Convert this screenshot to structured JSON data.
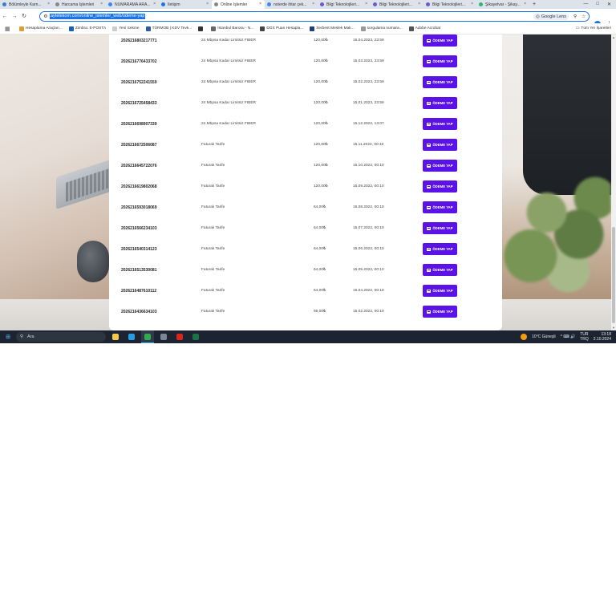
{
  "browser": {
    "tabs": [
      {
        "title": "Bölümleyle Karn...",
        "color": "#3a7bd5"
      },
      {
        "title": "Harcama İşlemleri",
        "color": "#888888"
      },
      {
        "title": "NUMARAMA ARA...",
        "color": "#4285f4"
      },
      {
        "title": "İletişim",
        "color": "#1a73e8"
      },
      {
        "title": "Online İşlemler",
        "color": "#888888"
      },
      {
        "title": "noterde ihtar çek...",
        "color": "#4285f4"
      },
      {
        "title": "Bilgi Teknolojileri...",
        "color": "#6a5acd"
      },
      {
        "title": "Bilgi Teknolojileri...",
        "color": "#6a5acd"
      },
      {
        "title": "Bilgi Teknolojileri...",
        "color": "#6a5acd"
      },
      {
        "title": "Şikayetvar - Şikay...",
        "color": "#2ab673"
      }
    ],
    "active_tab_index": 4,
    "new_tab": "+",
    "window_controls": [
      "—",
      "□",
      "✕"
    ],
    "nav": {
      "back": "←",
      "forward": "→",
      "reload": "↻"
    },
    "url": "aytelekom.com/online_islemler_web/odeme-yap",
    "lens_label": "Google Lens",
    "omnibox_icons": [
      "search-icon",
      "star-icon"
    ],
    "profile_initial": "●",
    "menu": "⋮",
    "apps_icon": "▦",
    "bookmarks": [
      {
        "label": "Hesaplama Araçları...",
        "color": "#e0a030"
      },
      {
        "label": "Zimbra: E-POSTA",
        "color": "#1a5fb4"
      },
      {
        "label": "Yeni Sekme",
        "color": "#cccccc"
      },
      {
        "label": "TÜRMOB | KDV Tevk...",
        "color": "#2c5aa0"
      },
      {
        "label": "",
        "color": "#333333"
      },
      {
        "label": "İstanbul Barosu - N...",
        "color": "#666666"
      },
      {
        "label": "DGS Puan Hesapla...",
        "color": "#444444"
      },
      {
        "label": "Serbest Meslek Mak...",
        "color": "#1f3d7a"
      },
      {
        "label": "sorgulama numara...",
        "color": "#999999"
      },
      {
        "label": "Adobe Acrobat",
        "color": "#555555"
      }
    ],
    "all_bookmarks": "Tüm Yer İşaretleri"
  },
  "payments": {
    "button_label": "ÖDEME YAP",
    "rows": [
      {
        "no": "2026216803217771",
        "plan": "24 Mbpsa Kadar Limitsiz FIBER",
        "amount": "120,00₺",
        "date": "15.04.2023, 23:59"
      },
      {
        "no": "2026216776433702",
        "plan": "24 Mbpsa Kadar Limitsiz FIBER",
        "amount": "120,00₺",
        "date": "15.03.2023, 23:59"
      },
      {
        "no": "2026216752241559",
        "plan": "24 Mbpsa Kadar Limitsiz FIBER",
        "amount": "120,00₺",
        "date": "15.02.2023, 23:59"
      },
      {
        "no": "2026216725458433",
        "plan": "24 Mbpsa Kadar Limitsiz FIBER",
        "amount": "120,00₺",
        "date": "15.01.2023, 23:59"
      },
      {
        "no": "2026216698907339",
        "plan": "24 Mbpsa Kadar Limitsiz FIBER",
        "amount": "120,00₺",
        "date": "15.12.2022, 13:07"
      },
      {
        "no": "2026216672506087",
        "plan": "Faturalı Tarife",
        "amount": "120,00₺",
        "date": "15.11.2022, 00:10"
      },
      {
        "no": "2026216645722076",
        "plan": "Faturalı Tarife",
        "amount": "120,00₺",
        "date": "15.10.2022, 00:10"
      },
      {
        "no": "2026216619802068",
        "plan": "Faturalı Tarife",
        "amount": "120,00₺",
        "date": "15.09.2022, 00:10"
      },
      {
        "no": "2026216593018069",
        "plan": "Faturalı Tarife",
        "amount": "64,00₺",
        "date": "15.08.2022, 00:10"
      },
      {
        "no": "2026216566234103",
        "plan": "Faturalı Tarife",
        "amount": "64,00₺",
        "date": "15.07.2022, 00:10"
      },
      {
        "no": "2026216540314123",
        "plan": "Faturalı Tarife",
        "amount": "64,00₺",
        "date": "15.06.2022, 00:10"
      },
      {
        "no": "2026216513530081",
        "plan": "Faturalı Tarife",
        "amount": "64,00₺",
        "date": "15.05.2022, 00:10"
      },
      {
        "no": "2026216487610112",
        "plan": "Faturalı Tarife",
        "amount": "64,00₺",
        "date": "15.04.2022, 00:10"
      },
      {
        "no": "2026216436634103",
        "plan": "Faturalı Tarife",
        "amount": "95,00₺",
        "date": "15.02.2022, 00:10"
      }
    ]
  },
  "taskbar": {
    "start_icon": "⊞",
    "search_placeholder": "Ara",
    "apps": [
      {
        "name": "file-explorer",
        "color": "#f2c94c"
      },
      {
        "name": "edge",
        "color": "#2b9be0"
      },
      {
        "name": "chrome",
        "color": "#34a853"
      },
      {
        "name": "calculator",
        "color": "#7a8794"
      },
      {
        "name": "acrobat",
        "color": "#d7261e"
      },
      {
        "name": "excel",
        "color": "#1e7145"
      }
    ],
    "active_app_index": 2,
    "weather": "10°C  Güneşli",
    "tray_icons": "^  ⌨  🔊",
    "lang_top": "TUR",
    "lang_bottom": "TRQ",
    "time": "13:18",
    "date": "2.10.2024"
  },
  "colors": {
    "accent": "#1a73e8",
    "pay_button": "#5b12e6",
    "taskbar": "#1b2430"
  }
}
